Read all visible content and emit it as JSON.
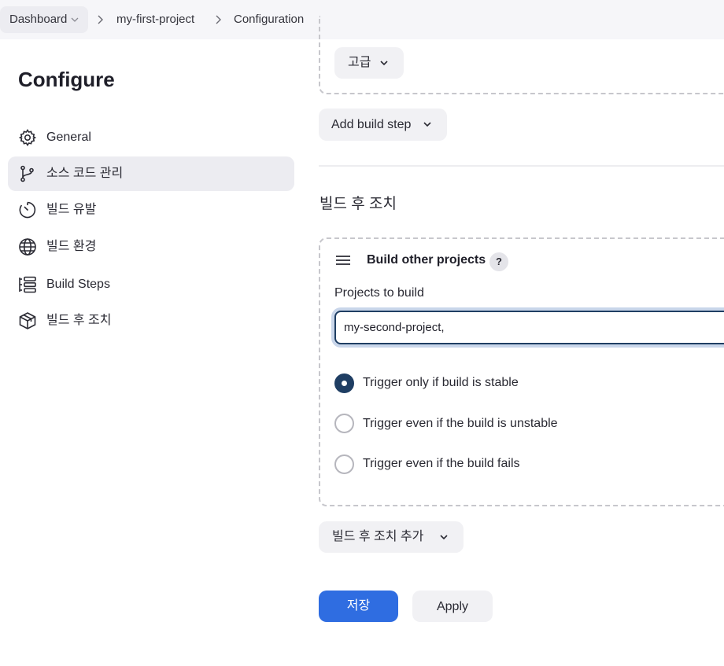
{
  "breadcrumb": {
    "items": [
      "Dashboard",
      "my-first-project",
      "Configuration"
    ]
  },
  "sidebar": {
    "title": "Configure",
    "items": [
      {
        "label": "General",
        "icon": "gear-icon"
      },
      {
        "label": "소스 코드 관리",
        "icon": "git-branch-icon",
        "active": true
      },
      {
        "label": "빌드 유발",
        "icon": "timer-icon"
      },
      {
        "label": "빌드 환경",
        "icon": "globe-icon"
      },
      {
        "label": "Build Steps",
        "icon": "list-steps-icon"
      },
      {
        "label": "빌드 후 조치",
        "icon": "package-icon"
      }
    ]
  },
  "main": {
    "advanced_label": "고급",
    "add_build_step_label": "Add build step",
    "post_build_heading": "빌드 후 조치",
    "block": {
      "title": "Build other projects",
      "help_label": "?",
      "field_label": "Projects to build",
      "field_value": "my-second-project,",
      "radios": [
        {
          "label": "Trigger only if build is stable",
          "checked": true
        },
        {
          "label": "Trigger even if the build is unstable",
          "checked": false
        },
        {
          "label": "Trigger even if the build fails",
          "checked": false
        }
      ]
    },
    "add_post_build_label": "빌드 후 조치 추가",
    "save_label": "저장",
    "apply_label": "Apply"
  },
  "colors": {
    "primary": "#2f6de1",
    "selected_radio": "#1f3e63",
    "sidebar_active_bg": "#ececf1"
  }
}
